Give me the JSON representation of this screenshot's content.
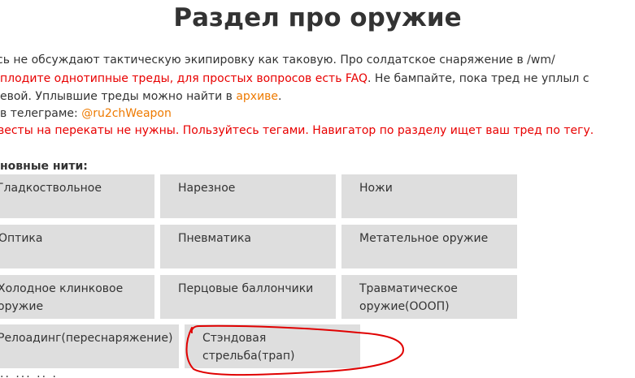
{
  "title": "Раздел про оружие",
  "lines": {
    "l1": "сь не обсуждают тактическую экипировку как таковую. Про солдатское снаряжение в /wm/",
    "l2_red": "плодите однотипные треды, для простых вопросов есть FAQ",
    "l2_rest": ". Не бампайте, пока тред не уплыл с",
    "l3_start": "евой. Уплывшие треды можно найти в ",
    "l3_link": "архиве",
    "l3_end": ".",
    "l4_start": " в телеграме: ",
    "l4_link": "@ru2chWeapon",
    "l5": "весты на перекаты не нужны. Пользуйтесь тегами. Навигатор по разделу ищет ваш тред по тегу."
  },
  "section_label": "новные нити:",
  "threads": [
    {
      "label": "Гладкоствольное"
    },
    {
      "label": "Нарезное"
    },
    {
      "label": "Ножи"
    },
    {
      "label": "Оптика"
    },
    {
      "label": "Пневматика"
    },
    {
      "label": "Метательное оружие"
    },
    {
      "label": "Холодное клинковое оружие",
      "line1": "Холодное клинковое",
      "line2": "оружие"
    },
    {
      "label": "Перцовые баллончики"
    },
    {
      "label": "Травматическое оружие(ОООП)",
      "line1": "Травматическое",
      "line2": "оружие(ОООП)"
    },
    {
      "label": "Релоадинг(переснаряжение)"
    },
    {
      "label": "Стэндовая стрельба(трап)",
      "line1": "Стэндовая",
      "line2": "стрельба(трап)"
    }
  ],
  "annotation": {
    "color": "#e00000"
  },
  "colors": {
    "text": "#333333",
    "red": "#e80000",
    "link": "#ee7a00",
    "cell_bg": "#dedede"
  }
}
